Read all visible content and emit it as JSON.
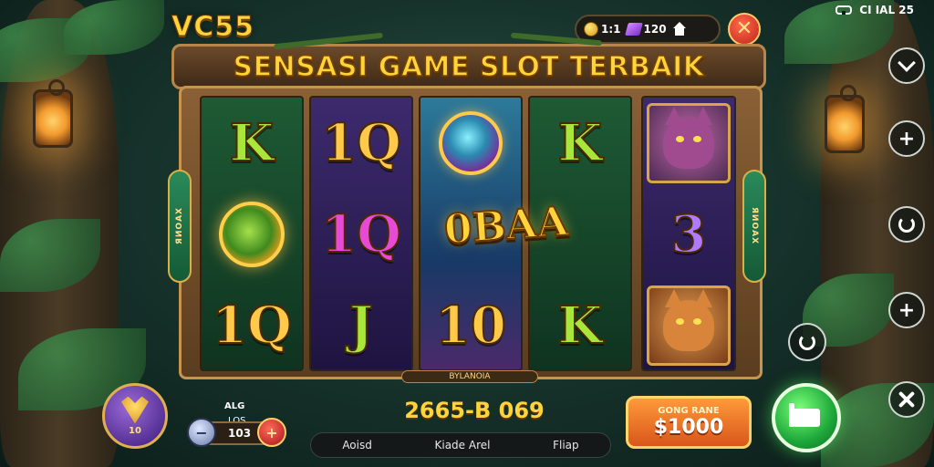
{
  "header": {
    "logo": "VC55",
    "banner_title": "SENSASI GAME SLOT TERBAIK",
    "status_text": "CI IAL 25"
  },
  "currencies": [
    {
      "icon": "coin-icon",
      "value": "1:1"
    },
    {
      "icon": "gem-icon",
      "value": "120"
    },
    {
      "icon": "home-icon",
      "value": ""
    }
  ],
  "reels": [
    {
      "symbols": [
        "K",
        "sun-medallion",
        "10"
      ]
    },
    {
      "symbols": [
        "1Q",
        "1Q",
        "J"
      ]
    },
    {
      "symbols": [
        "orb-gem",
        "0",
        "10"
      ]
    },
    {
      "symbols": [
        "K",
        "K",
        "K"
      ]
    },
    {
      "symbols": [
        "panther-beast",
        "3",
        "cougar-beast"
      ]
    }
  ],
  "symbol_text": {
    "r1s0": "K",
    "r1s2": "1Q",
    "r2s0": "1Q",
    "r2s1": "1Q",
    "r2s2": "J",
    "r3s2": "10",
    "r4s0": "K",
    "r4s2": "K",
    "r5s1": "3"
  },
  "win_overlay": "0BAA",
  "side_tabs": {
    "left": "ЯИОАХ",
    "right": "ЯИОАХ"
  },
  "reel_strip_label": "BYLANOIA",
  "bottom": {
    "level_badge": "10",
    "bet_label": "ALG",
    "bet_sub": "LOS",
    "bet_value": "103",
    "balance": "2665-B 069",
    "strip_items": [
      "Aoisd",
      "Kiade Arel",
      "Fliap"
    ],
    "gold_button_small": "GONG RANE",
    "gold_button_amount": "$1000"
  },
  "colors": {
    "accent_gold": "#ffd43b",
    "spin_green": "#1ea83a",
    "close_red": "#c0241b"
  }
}
